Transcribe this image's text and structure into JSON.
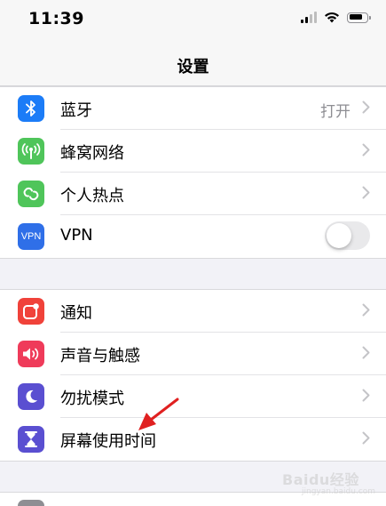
{
  "status_bar": {
    "time": "11:39",
    "battery_level": 0.8
  },
  "nav": {
    "title": "设置"
  },
  "groups": [
    {
      "items": [
        {
          "label": "蓝牙",
          "value": "打开",
          "icon": "bluetooth-icon",
          "color": "#1c7cf7",
          "accessory": "chevron"
        },
        {
          "label": "蜂窝网络",
          "icon": "antenna-icon",
          "color": "#4fc55a",
          "accessory": "chevron"
        },
        {
          "label": "个人热点",
          "icon": "hotspot-link-icon",
          "color": "#4fc55a",
          "accessory": "chevron"
        },
        {
          "label": "VPN",
          "icon_text": "VPN",
          "icon": "vpn-icon",
          "color": "#2f6fe8",
          "accessory": "toggle",
          "toggle_on": false
        }
      ]
    },
    {
      "items": [
        {
          "label": "通知",
          "icon": "notification-icon",
          "color": "#f0423a",
          "accessory": "chevron"
        },
        {
          "label": "声音与触感",
          "icon": "speaker-icon",
          "color": "#ef3b5a",
          "accessory": "chevron"
        },
        {
          "label": "勿扰模式",
          "icon": "moon-icon",
          "color": "#5a4fd1",
          "accessory": "chevron"
        },
        {
          "label": "屏幕使用时间",
          "icon": "hourglass-icon",
          "color": "#5a4fd1",
          "accessory": "chevron"
        }
      ]
    }
  ],
  "annotation_color": "#e02020",
  "watermark": {
    "text": "Baidu经验",
    "sub": "jingyan.baidu.com"
  }
}
